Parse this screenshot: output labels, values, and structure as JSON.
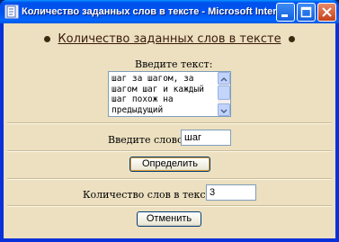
{
  "window": {
    "title": "Количество заданных слов в тексте - Microsoft Internet Explor"
  },
  "page": {
    "heading": "Количество заданных слов в тексте",
    "text_label": "Введите текст:",
    "text_value": "шаг за шагом, за шагом шаг и каждый шаг похож на предыдущий",
    "word_label": "Введите слово:",
    "word_value": "шаг",
    "determine_button": "Определить",
    "count_label": "Количество слов в тексте:",
    "count_value": "3",
    "cancel_button": "Отменить"
  }
}
